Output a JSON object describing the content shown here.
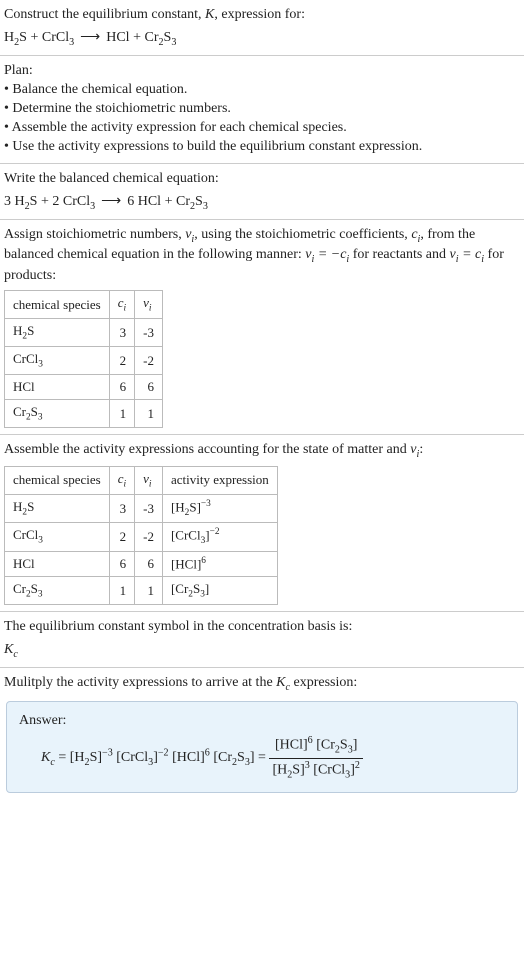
{
  "intro": {
    "line1_a": "Construct the equilibrium constant, ",
    "line1_b": ", expression for:"
  },
  "reaction_unbalanced": {
    "H2S": "H",
    "H2S_2": "2",
    "H2S_S": "S",
    "plus1": " + ",
    "CrCl3_Cr": "CrCl",
    "CrCl3_3": "3",
    "arrow": "⟶",
    "HCl": "HCl",
    "plus2": " + ",
    "Cr2S3_Cr": "Cr",
    "Cr2S3_2": "2",
    "Cr2S3_S": "S",
    "Cr2S3_3": "3"
  },
  "plan": {
    "header": "Plan:",
    "b1": "• Balance the chemical equation.",
    "b2": "• Determine the stoichiometric numbers.",
    "b3": "• Assemble the activity expression for each chemical species.",
    "b4": "• Use the activity expressions to build the equilibrium constant expression."
  },
  "balanced_header": "Write the balanced chemical equation:",
  "balanced": {
    "c1": "3 ",
    "c2": "2 ",
    "c3": "6 "
  },
  "stoich_text_a": "Assign stoichiometric numbers, ",
  "stoich_text_b": ", using the stoichiometric coefficients, ",
  "stoich_text_c": ", from the balanced chemical equation in the following manner: ",
  "stoich_text_d": " for reactants and ",
  "stoich_text_e": " for products:",
  "table1": {
    "h1": "chemical species",
    "rows": [
      {
        "c": "3",
        "v": "-3"
      },
      {
        "c": "2",
        "v": "-2"
      },
      {
        "c": "6",
        "v": "6"
      },
      {
        "c": "1",
        "v": "1"
      }
    ]
  },
  "assemble_text": "Assemble the activity expressions accounting for the state of matter and ",
  "table2": {
    "h4": "activity expression"
  },
  "kc_text": "The equilibrium constant symbol in the concentration basis is:",
  "mult_text_a": "Mulitply the activity expressions to arrive at the ",
  "mult_text_b": " expression:",
  "answer_label": "Answer:",
  "eq_sign": " = ",
  "colon": ":",
  "K": "K",
  "K_c": "c",
  "nu": "ν",
  "i": "i",
  "c": "c",
  "minus": "−",
  "chart_data": {
    "type": "table",
    "title": "Stoichiometric numbers and activity expressions",
    "tables": [
      {
        "columns": [
          "chemical species",
          "c_i",
          "ν_i"
        ],
        "rows": [
          [
            "H2S",
            3,
            -3
          ],
          [
            "CrCl3",
            2,
            -2
          ],
          [
            "HCl",
            6,
            6
          ],
          [
            "Cr2S3",
            1,
            1
          ]
        ]
      },
      {
        "columns": [
          "chemical species",
          "c_i",
          "ν_i",
          "activity expression"
        ],
        "rows": [
          [
            "H2S",
            3,
            -3,
            "[H2S]^-3"
          ],
          [
            "CrCl3",
            2,
            -2,
            "[CrCl3]^-2"
          ],
          [
            "HCl",
            6,
            6,
            "[HCl]^6"
          ],
          [
            "Cr2S3",
            1,
            1,
            "[Cr2S3]"
          ]
        ]
      }
    ]
  }
}
